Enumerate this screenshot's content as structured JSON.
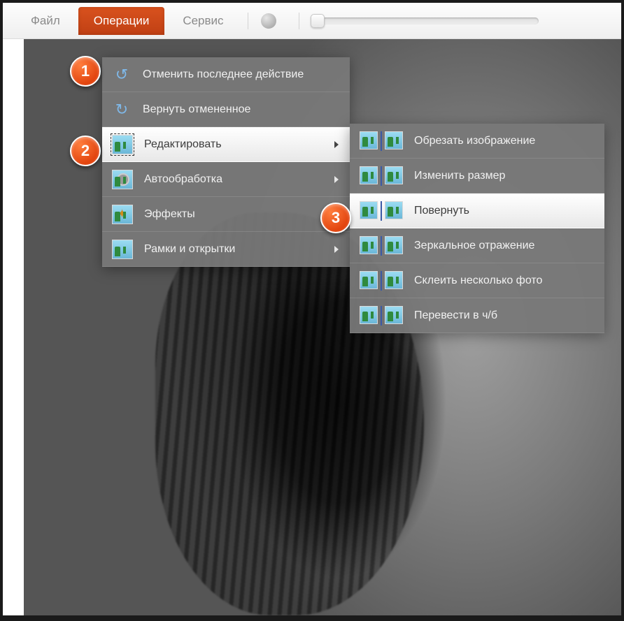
{
  "menubar": {
    "file": "Файл",
    "operations": "Операции",
    "service": "Сервис"
  },
  "dropdown": {
    "undo": "Отменить последнее действие",
    "redo": "Вернуть отмененное",
    "edit": "Редактировать",
    "auto": "Автообработка",
    "effects": "Эффекты",
    "frames": "Рамки и открытки"
  },
  "submenu": {
    "crop": "Обрезать изображение",
    "resize": "Изменить размер",
    "rotate": "Повернуть",
    "mirror": "Зеркальное отражение",
    "merge": "Склеить несколько фото",
    "bw": "Перевести в ч/б"
  },
  "callouts": {
    "c1": "1",
    "c2": "2",
    "c3": "3"
  }
}
